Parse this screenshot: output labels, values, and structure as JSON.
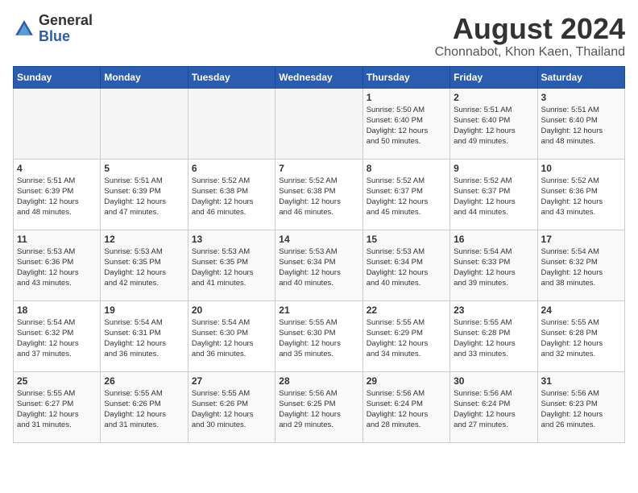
{
  "header": {
    "logo_general": "General",
    "logo_blue": "Blue",
    "title": "August 2024",
    "subtitle": "Chonnabot, Khon Kaen, Thailand"
  },
  "weekdays": [
    "Sunday",
    "Monday",
    "Tuesday",
    "Wednesday",
    "Thursday",
    "Friday",
    "Saturday"
  ],
  "weeks": [
    [
      {
        "day": "",
        "info": ""
      },
      {
        "day": "",
        "info": ""
      },
      {
        "day": "",
        "info": ""
      },
      {
        "day": "",
        "info": ""
      },
      {
        "day": "1",
        "info": "Sunrise: 5:50 AM\nSunset: 6:40 PM\nDaylight: 12 hours\nand 50 minutes."
      },
      {
        "day": "2",
        "info": "Sunrise: 5:51 AM\nSunset: 6:40 PM\nDaylight: 12 hours\nand 49 minutes."
      },
      {
        "day": "3",
        "info": "Sunrise: 5:51 AM\nSunset: 6:40 PM\nDaylight: 12 hours\nand 48 minutes."
      }
    ],
    [
      {
        "day": "4",
        "info": "Sunrise: 5:51 AM\nSunset: 6:39 PM\nDaylight: 12 hours\nand 48 minutes."
      },
      {
        "day": "5",
        "info": "Sunrise: 5:51 AM\nSunset: 6:39 PM\nDaylight: 12 hours\nand 47 minutes."
      },
      {
        "day": "6",
        "info": "Sunrise: 5:52 AM\nSunset: 6:38 PM\nDaylight: 12 hours\nand 46 minutes."
      },
      {
        "day": "7",
        "info": "Sunrise: 5:52 AM\nSunset: 6:38 PM\nDaylight: 12 hours\nand 46 minutes."
      },
      {
        "day": "8",
        "info": "Sunrise: 5:52 AM\nSunset: 6:37 PM\nDaylight: 12 hours\nand 45 minutes."
      },
      {
        "day": "9",
        "info": "Sunrise: 5:52 AM\nSunset: 6:37 PM\nDaylight: 12 hours\nand 44 minutes."
      },
      {
        "day": "10",
        "info": "Sunrise: 5:52 AM\nSunset: 6:36 PM\nDaylight: 12 hours\nand 43 minutes."
      }
    ],
    [
      {
        "day": "11",
        "info": "Sunrise: 5:53 AM\nSunset: 6:36 PM\nDaylight: 12 hours\nand 43 minutes."
      },
      {
        "day": "12",
        "info": "Sunrise: 5:53 AM\nSunset: 6:35 PM\nDaylight: 12 hours\nand 42 minutes."
      },
      {
        "day": "13",
        "info": "Sunrise: 5:53 AM\nSunset: 6:35 PM\nDaylight: 12 hours\nand 41 minutes."
      },
      {
        "day": "14",
        "info": "Sunrise: 5:53 AM\nSunset: 6:34 PM\nDaylight: 12 hours\nand 40 minutes."
      },
      {
        "day": "15",
        "info": "Sunrise: 5:53 AM\nSunset: 6:34 PM\nDaylight: 12 hours\nand 40 minutes."
      },
      {
        "day": "16",
        "info": "Sunrise: 5:54 AM\nSunset: 6:33 PM\nDaylight: 12 hours\nand 39 minutes."
      },
      {
        "day": "17",
        "info": "Sunrise: 5:54 AM\nSunset: 6:32 PM\nDaylight: 12 hours\nand 38 minutes."
      }
    ],
    [
      {
        "day": "18",
        "info": "Sunrise: 5:54 AM\nSunset: 6:32 PM\nDaylight: 12 hours\nand 37 minutes."
      },
      {
        "day": "19",
        "info": "Sunrise: 5:54 AM\nSunset: 6:31 PM\nDaylight: 12 hours\nand 36 minutes."
      },
      {
        "day": "20",
        "info": "Sunrise: 5:54 AM\nSunset: 6:30 PM\nDaylight: 12 hours\nand 36 minutes."
      },
      {
        "day": "21",
        "info": "Sunrise: 5:55 AM\nSunset: 6:30 PM\nDaylight: 12 hours\nand 35 minutes."
      },
      {
        "day": "22",
        "info": "Sunrise: 5:55 AM\nSunset: 6:29 PM\nDaylight: 12 hours\nand 34 minutes."
      },
      {
        "day": "23",
        "info": "Sunrise: 5:55 AM\nSunset: 6:28 PM\nDaylight: 12 hours\nand 33 minutes."
      },
      {
        "day": "24",
        "info": "Sunrise: 5:55 AM\nSunset: 6:28 PM\nDaylight: 12 hours\nand 32 minutes."
      }
    ],
    [
      {
        "day": "25",
        "info": "Sunrise: 5:55 AM\nSunset: 6:27 PM\nDaylight: 12 hours\nand 31 minutes."
      },
      {
        "day": "26",
        "info": "Sunrise: 5:55 AM\nSunset: 6:26 PM\nDaylight: 12 hours\nand 31 minutes."
      },
      {
        "day": "27",
        "info": "Sunrise: 5:55 AM\nSunset: 6:26 PM\nDaylight: 12 hours\nand 30 minutes."
      },
      {
        "day": "28",
        "info": "Sunrise: 5:56 AM\nSunset: 6:25 PM\nDaylight: 12 hours\nand 29 minutes."
      },
      {
        "day": "29",
        "info": "Sunrise: 5:56 AM\nSunset: 6:24 PM\nDaylight: 12 hours\nand 28 minutes."
      },
      {
        "day": "30",
        "info": "Sunrise: 5:56 AM\nSunset: 6:24 PM\nDaylight: 12 hours\nand 27 minutes."
      },
      {
        "day": "31",
        "info": "Sunrise: 5:56 AM\nSunset: 6:23 PM\nDaylight: 12 hours\nand 26 minutes."
      }
    ]
  ]
}
